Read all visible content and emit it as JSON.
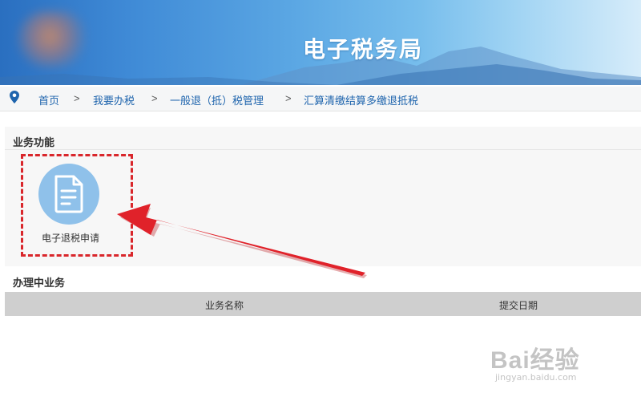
{
  "header": {
    "title": "电子税务局"
  },
  "breadcrumb": {
    "items": [
      "首页",
      "我要办税",
      "一般退（抵）税管理",
      "汇算清缴结算多缴退抵税"
    ],
    "separator": ">"
  },
  "business_functions": {
    "heading": "业务功能",
    "tiles": [
      {
        "label": "电子退税申请",
        "icon": "document-icon"
      }
    ]
  },
  "in_progress": {
    "heading": "办理中业务",
    "columns": [
      "业务名称",
      "提交日期"
    ]
  },
  "watermark": {
    "brand": "Bai经验",
    "url": "jingyan.baidu.com"
  },
  "colors": {
    "breadcrumb_link": "#1e64ad",
    "tile_circle": "#8fc1ea",
    "highlight_red": "#d9262b"
  }
}
